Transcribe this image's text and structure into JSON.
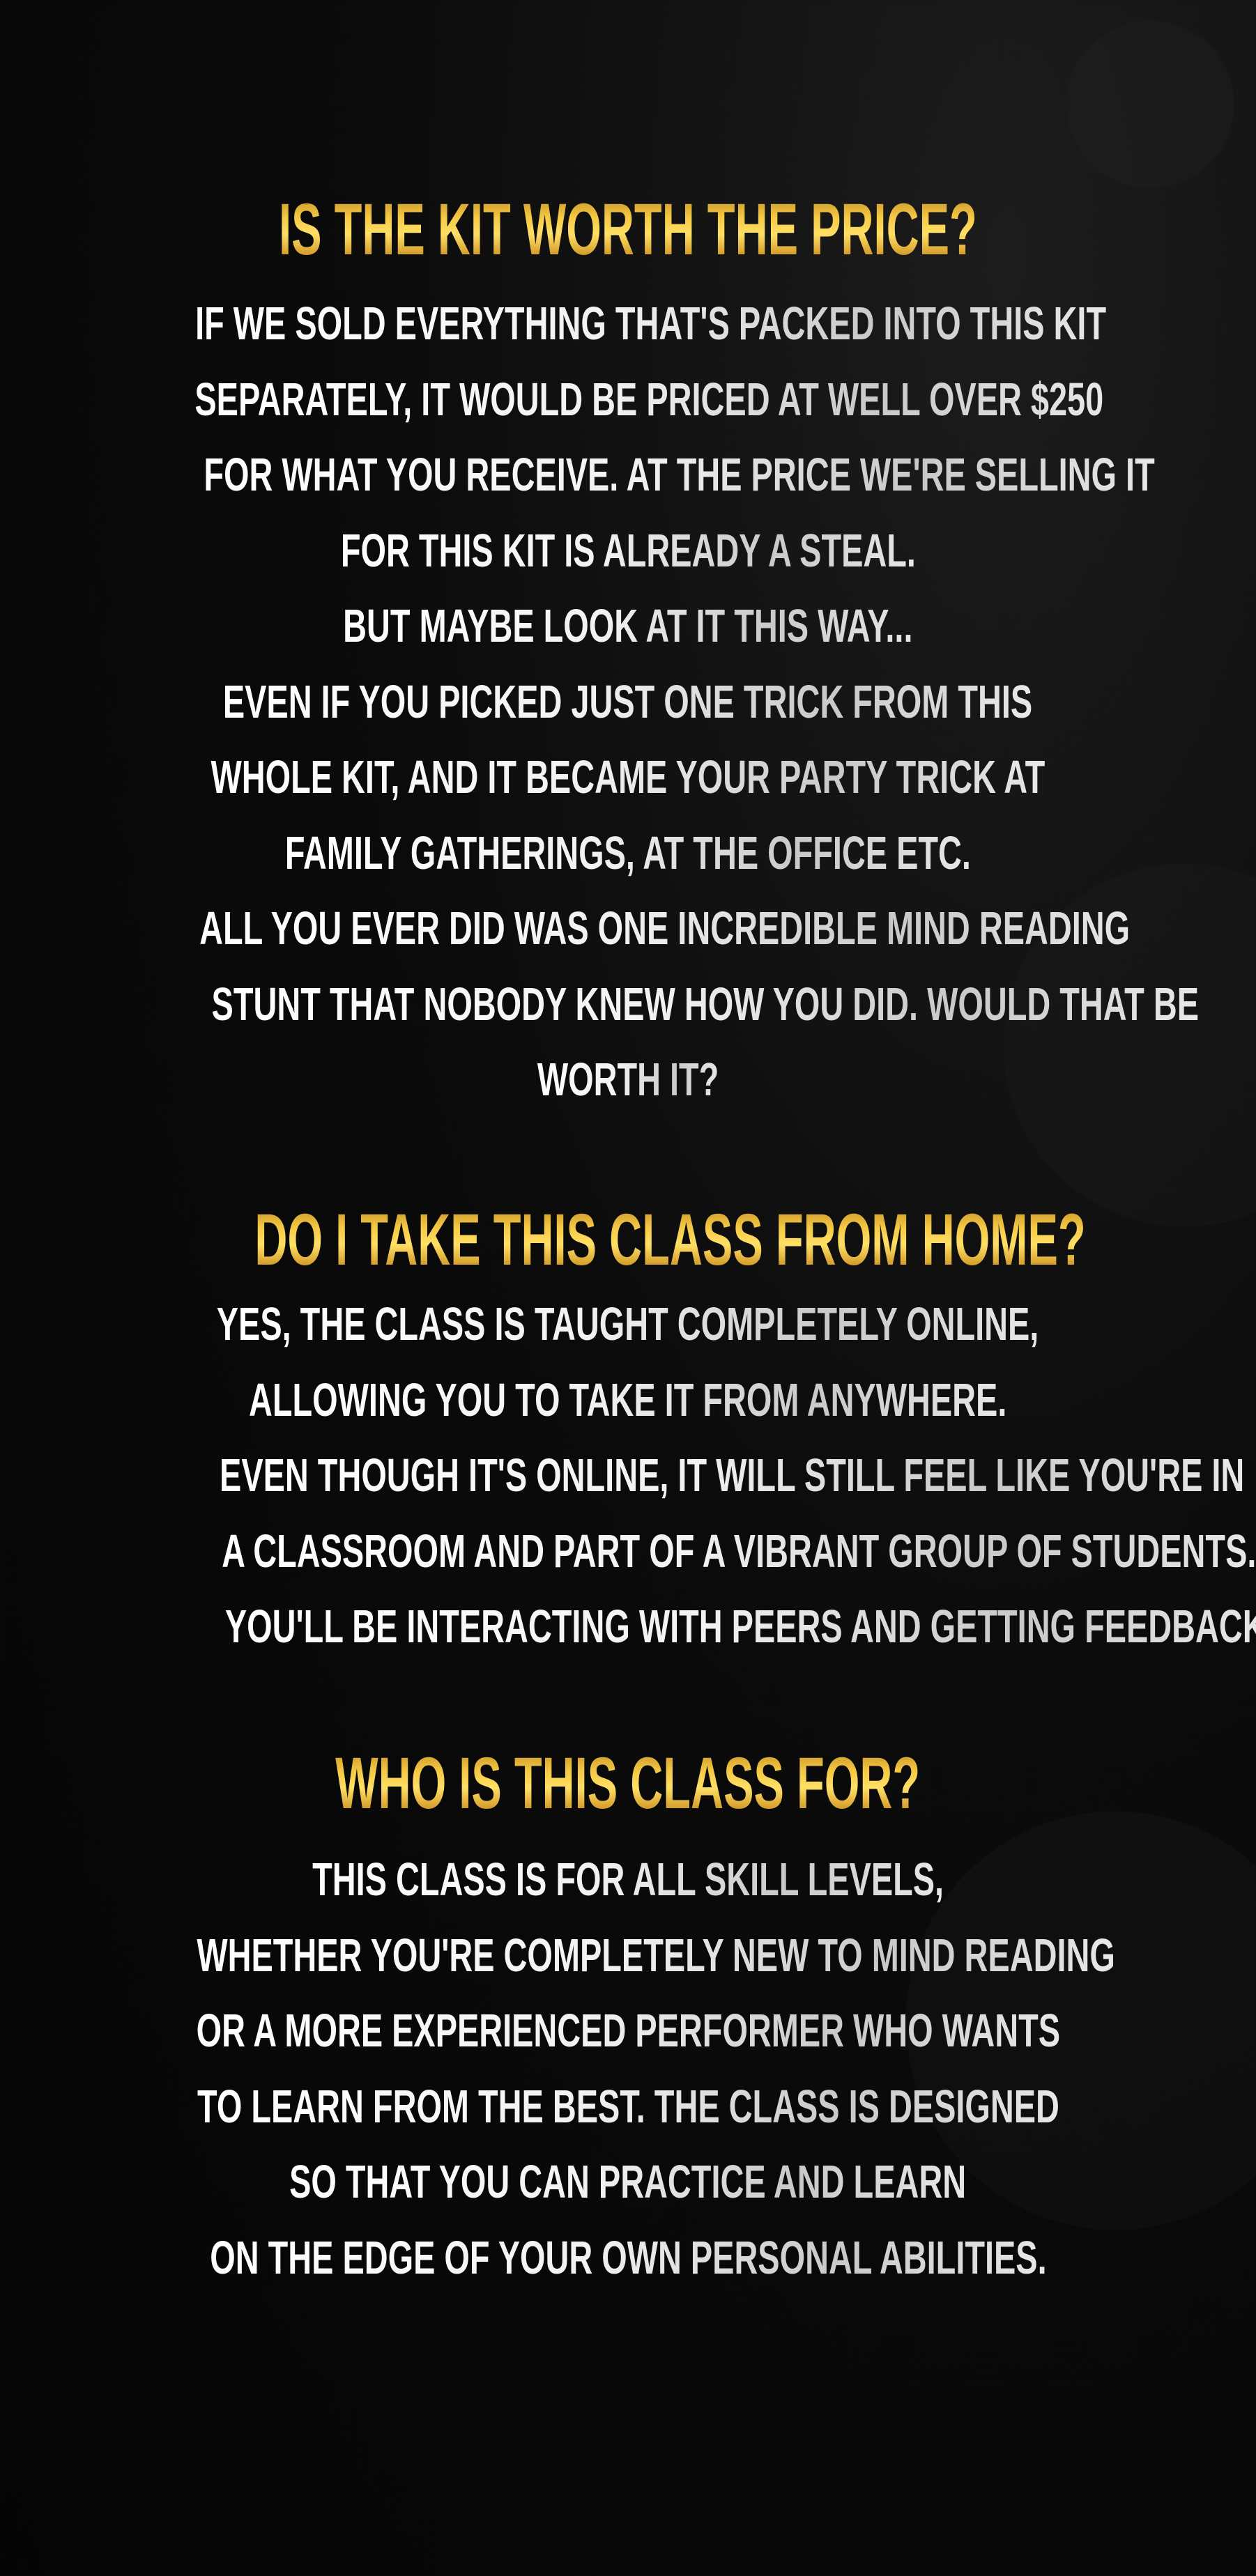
{
  "sections": [
    {
      "heading": "IS THE KIT WORTH THE PRICE?",
      "lines": [
        "IF WE SOLD EVERYTHING THAT'S PACKED INTO THIS KIT",
        "SEPARATELY, IT WOULD BE PRICED AT WELL OVER $250",
        "FOR WHAT YOU RECEIVE. AT THE PRICE WE'RE SELLING IT",
        "FOR THIS KIT IS ALREADY A STEAL.",
        "BUT MAYBE LOOK AT IT THIS WAY...",
        "EVEN IF YOU PICKED JUST ONE TRICK FROM THIS",
        "WHOLE KIT, AND IT BECAME YOUR PARTY TRICK AT",
        "FAMILY GATHERINGS, AT THE OFFICE ETC.",
        "ALL YOU EVER DID WAS ONE INCREDIBLE MIND READING",
        "STUNT THAT NOBODY KNEW HOW YOU DID.  WOULD THAT BE",
        "WORTH IT?"
      ]
    },
    {
      "heading": "DO I TAKE THIS CLASS FROM HOME?",
      "lines": [
        "YES, THE CLASS IS TAUGHT COMPLETELY ONLINE,",
        "ALLOWING YOU TO TAKE IT FROM ANYWHERE.",
        "EVEN THOUGH IT'S ONLINE, IT WILL STILL FEEL LIKE YOU'RE IN",
        "A CLASSROOM AND PART OF A VIBRANT GROUP OF STUDENTS.",
        "YOU'LL BE INTERACTING WITH PEERS AND GETTING FEEDBACK."
      ]
    },
    {
      "heading": "WHO IS THIS CLASS FOR?",
      "lines": [
        "THIS CLASS IS FOR ALL SKILL LEVELS,",
        "WHETHER YOU'RE COMPLETELY NEW TO MIND READING",
        "OR A MORE EXPERIENCED PERFORMER WHO WANTS",
        "TO LEARN FROM  THE BEST. THE CLASS IS DESIGNED",
        "SO THAT YOU CAN PRACTICE AND LEARN",
        "ON THE EDGE OF YOUR OWN PERSONAL ABILITIES."
      ]
    }
  ],
  "colors": {
    "heading_gold": "#f5c944",
    "body_silver": "#f2f2f2",
    "background": "#080808"
  }
}
